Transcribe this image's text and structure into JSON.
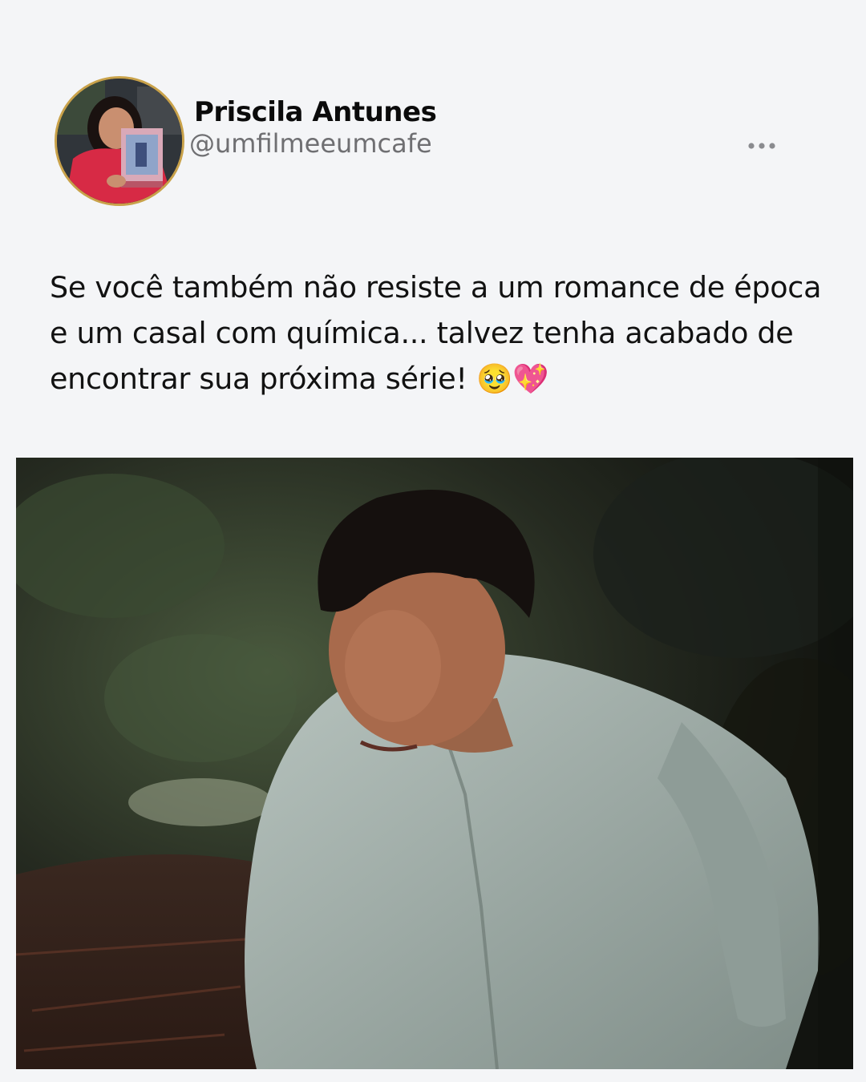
{
  "author": {
    "display_name": "Priscila Antunes",
    "handle": "@umfilmeeumcafe",
    "avatar_icon": "profile-photo-avatar"
  },
  "menu": {
    "icon": "more-horizontal-icon"
  },
  "post": {
    "text": "Se você também não resiste a um romance de época e um casal com química... talvez tenha acabado de encontrar sua próxima série! 🥹💖"
  },
  "media": {
    "description_icon": "post-photo"
  },
  "colors": {
    "background": "#f4f5f7",
    "name": "#0b0b0b",
    "handle": "#6f6f72",
    "avatar_ring": "#c9a24a"
  }
}
